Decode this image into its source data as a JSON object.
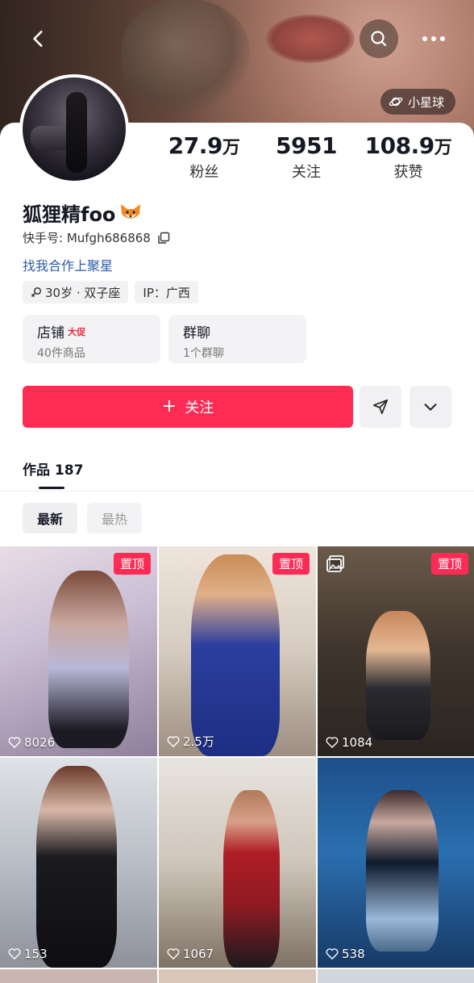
{
  "header": {
    "back_icon": "chevron-left-icon",
    "search_icon": "search-icon",
    "more_icon": "more-dots-icon",
    "planet_label": "小星球"
  },
  "profile": {
    "name": "狐狸精foo",
    "name_emoji": "fox-icon",
    "uid": "快手号: Mufgh686868",
    "cta": "找我合作上聚星",
    "stats": [
      {
        "num": "27.9",
        "unit": "万",
        "label": "粉丝"
      },
      {
        "num": "5951",
        "unit": "",
        "label": "关注"
      },
      {
        "num": "108.9",
        "unit": "万",
        "label": "获赞"
      }
    ],
    "tags": [
      {
        "icon": "gender-icon",
        "text": "30岁 · 双子座"
      },
      {
        "icon": "",
        "text": "IP：广西"
      }
    ],
    "boxes": [
      {
        "title": "店铺",
        "badge": "大促",
        "sub": "40件商品"
      },
      {
        "title": "群聊",
        "badge": "",
        "sub": "1个群聊"
      }
    ],
    "follow_label": "关注"
  },
  "works": {
    "tab_label": "作品",
    "count": "187",
    "sort": [
      "最新",
      "最热"
    ],
    "pin_label": "置顶",
    "tiles": [
      {
        "likes": "8026",
        "pinned": true
      },
      {
        "likes": "2.5万",
        "pinned": true
      },
      {
        "likes": "1084",
        "pinned": true
      },
      {
        "likes": "153",
        "pinned": false
      },
      {
        "likes": "1067",
        "pinned": false
      },
      {
        "likes": "538",
        "pinned": false
      }
    ]
  },
  "colors": {
    "accent": "#fe2c55",
    "link": "#2b5ba7"
  }
}
